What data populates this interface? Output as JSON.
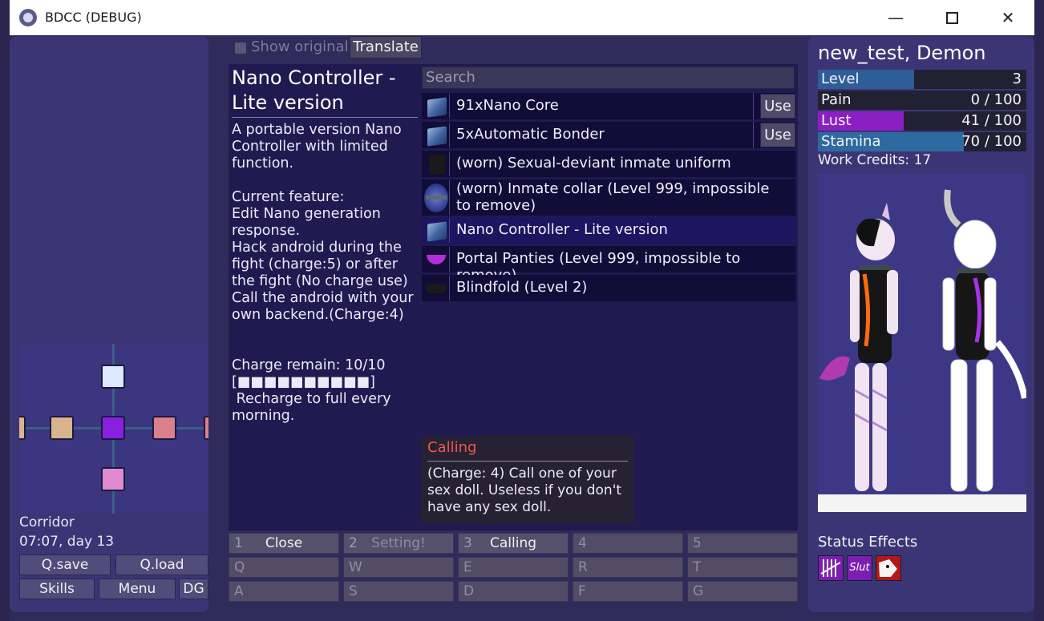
{
  "window": {
    "title": "BDCC (DEBUG)",
    "minimize": "—",
    "close": "✕"
  },
  "toolbar": {
    "show_original": "Show original",
    "translate": "Translate"
  },
  "item": {
    "title": "Nano Controller - Lite version",
    "description": "A portable version Nano Controller with limited function.\n\nCurrent feature:\nEdit Nano generation response.\nHack android during the fight (charge:5) or after the fight (No charge use)\nCall the android with your own backend.(Charge:4)\n\n\nCharge remain: 10/10\n[■■■■■■■■■■]\n Recharge to full every morning."
  },
  "search": {
    "placeholder": "Search"
  },
  "inventory": [
    {
      "name": "91xNano Core",
      "use": "Use"
    },
    {
      "name": "5xAutomatic Bonder",
      "use": "Use"
    },
    {
      "name": "(worn) Sexual-deviant inmate uniform"
    },
    {
      "name": "(worn) Inmate collar (Level 999, impossible to remove)"
    },
    {
      "name": "Nano Controller - Lite version"
    },
    {
      "name": "Portal Panties (Level 999, impossible to remove)"
    },
    {
      "name": "Blindfold (Level 2)"
    }
  ],
  "tooltip": {
    "title": "Calling",
    "body": "(Charge: 4) Call one of your sex doll. Useless if you don't have any sex doll."
  },
  "hotkeys": [
    {
      "key": "1",
      "label": "Close"
    },
    {
      "key": "2",
      "label": "Setting!"
    },
    {
      "key": "3",
      "label": "Calling"
    },
    {
      "key": "4",
      "label": ""
    },
    {
      "key": "5",
      "label": ""
    },
    {
      "key": "Q",
      "label": ""
    },
    {
      "key": "W",
      "label": ""
    },
    {
      "key": "E",
      "label": ""
    },
    {
      "key": "R",
      "label": ""
    },
    {
      "key": "T",
      "label": ""
    },
    {
      "key": "A",
      "label": ""
    },
    {
      "key": "S",
      "label": ""
    },
    {
      "key": "D",
      "label": ""
    },
    {
      "key": "F",
      "label": ""
    },
    {
      "key": "G",
      "label": ""
    }
  ],
  "left": {
    "location": "Corridor",
    "time": "07:07, day 13",
    "buttons": {
      "qsave": "Q.save",
      "qload": "Q.load",
      "skills": "Skills",
      "menu": "Menu",
      "dg": "DG"
    }
  },
  "character": {
    "name": "new_test, Demon",
    "stats": [
      {
        "label": "Level",
        "value": "3",
        "fill": 0.46,
        "color": "#2e5d97"
      },
      {
        "label": "Pain",
        "value": "0 / 100",
        "fill": 0.0,
        "color": "#a83232"
      },
      {
        "label": "Lust",
        "value": "41 / 100",
        "fill": 0.41,
        "color": "#8a1fc4"
      },
      {
        "label": "Stamina",
        "value": "70 / 100",
        "fill": 0.7,
        "color": "#2e6aa0"
      }
    ],
    "credits": "Work Credits: 17",
    "status_title": "Status Effects",
    "status_effects": [
      {
        "icon": "barcode-icon",
        "color": "#7a1fb0"
      },
      {
        "icon": "slut-icon",
        "text": "Slut",
        "color": "#7a1fb0"
      },
      {
        "icon": "dog-mask-icon",
        "color": "#b51818"
      }
    ]
  },
  "minimap": {
    "rooms": [
      {
        "name": "north-room",
        "color": "#dde8ff"
      },
      {
        "name": "current-room",
        "color": "#8a1fe0"
      },
      {
        "name": "west-room",
        "color": "#d9b38c"
      },
      {
        "name": "east-room",
        "color": "#d9808c"
      },
      {
        "name": "south-room",
        "color": "#e08ad0"
      }
    ]
  }
}
